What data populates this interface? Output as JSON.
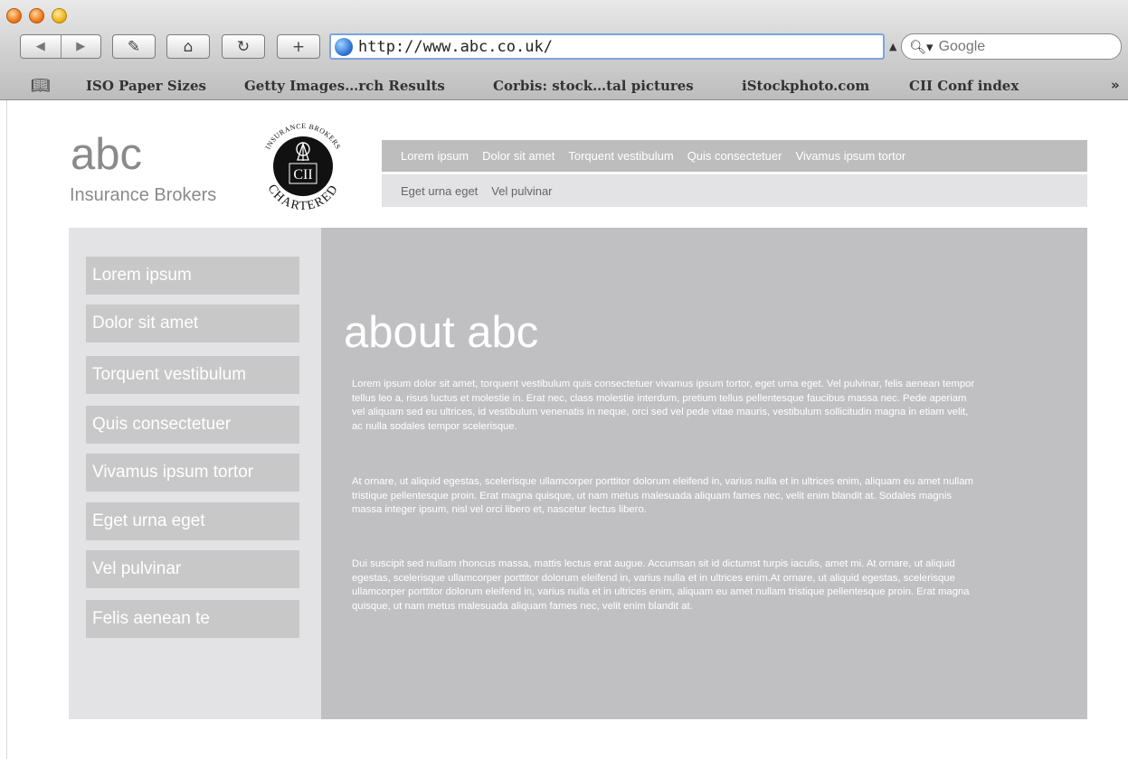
{
  "browser": {
    "url": "http://www.abc.co.uk/",
    "search_placeholder": "Google",
    "bookmarks": [
      "ISO Paper Sizes",
      "Getty Images…rch Results",
      "Corbis: stock…tal pictures",
      "iStockphoto.com",
      "CII Conf index"
    ],
    "bookmarks_more": "»"
  },
  "logo": {
    "name": "abc",
    "subtitle": "Insurance Brokers"
  },
  "seal": {
    "top_text": "INSURANCE BROKERS",
    "center_text": "CII",
    "bottom_text": "CHARTERED"
  },
  "top_nav": {
    "row1": [
      "Lorem ipsum",
      "Dolor sit amet",
      "Torquent vestibulum",
      "Quis consectetuer",
      "Vivamus ipsum tortor"
    ],
    "row2": [
      "Eget urna eget",
      "Vel pulvinar"
    ]
  },
  "sidebar": {
    "items": [
      "Lorem ipsum",
      "Dolor sit amet",
      "Torquent vestibulum",
      "Quis consectetuer",
      "Vivamus ipsum tortor",
      "Eget urna eget",
      "Vel pulvinar",
      "Felis aenean te"
    ]
  },
  "main": {
    "title": "about abc",
    "paragraphs": [
      "Lorem ipsum dolor sit amet, torquent vestibulum quis consectetuer vivamus ipsum tortor, eget urna eget. Vel pulvinar, felis aenean tempor tellus leo a, risus luctus et molestie in. Erat nec, class molestie interdum, pretium tellus pellentesque faucibus massa nec. Pede aperiam vel aliquam sed eu ultrices, id vestibulum venenatis in neque, orci sed vel pede vitae mauris, vestibulum sollicitudin magna in etiam velit, ac nulla sodales tempor scelerisque.",
      "At ornare, ut aliquid egestas, scelerisque ullamcorper porttitor dolorum eleifend in, varius nulla et in ultrices enim, aliquam eu amet nullam tristique pellentesque proin. Erat magna quisque, ut nam metus malesuada aliquam fames nec, velit enim blandit at. Sodales magnis massa integer ipsum, nisl vel orci libero et, nascetur lectus libero.",
      "Dui suscipit sed nullam rhoncus massa, mattis lectus erat augue. Accumsan sit id dictumst turpis iaculis, amet mi. At ornare, ut aliquid egestas, scelerisque ullamcorper porttitor dolorum eleifend in, varius nulla et in ultrices enim.At ornare, ut aliquid egestas, scelerisque ullamcorper porttitor dolorum eleifend in, varius nulla et in ultrices enim, aliquam eu amet nullam tristique pellentesque proin. Erat magna quisque, ut nam metus malesuada aliquam fames nec, velit enim blandit at."
    ]
  },
  "colors": {
    "top_nav_dark": "#bdbdbd",
    "top_nav_light": "#e3e3e5",
    "sidebar_bg": "#e3e3e5",
    "sidebar_item": "#c8c8c8",
    "main_bg": "#c0c0c2",
    "logo_text": "#8a8a8a"
  }
}
